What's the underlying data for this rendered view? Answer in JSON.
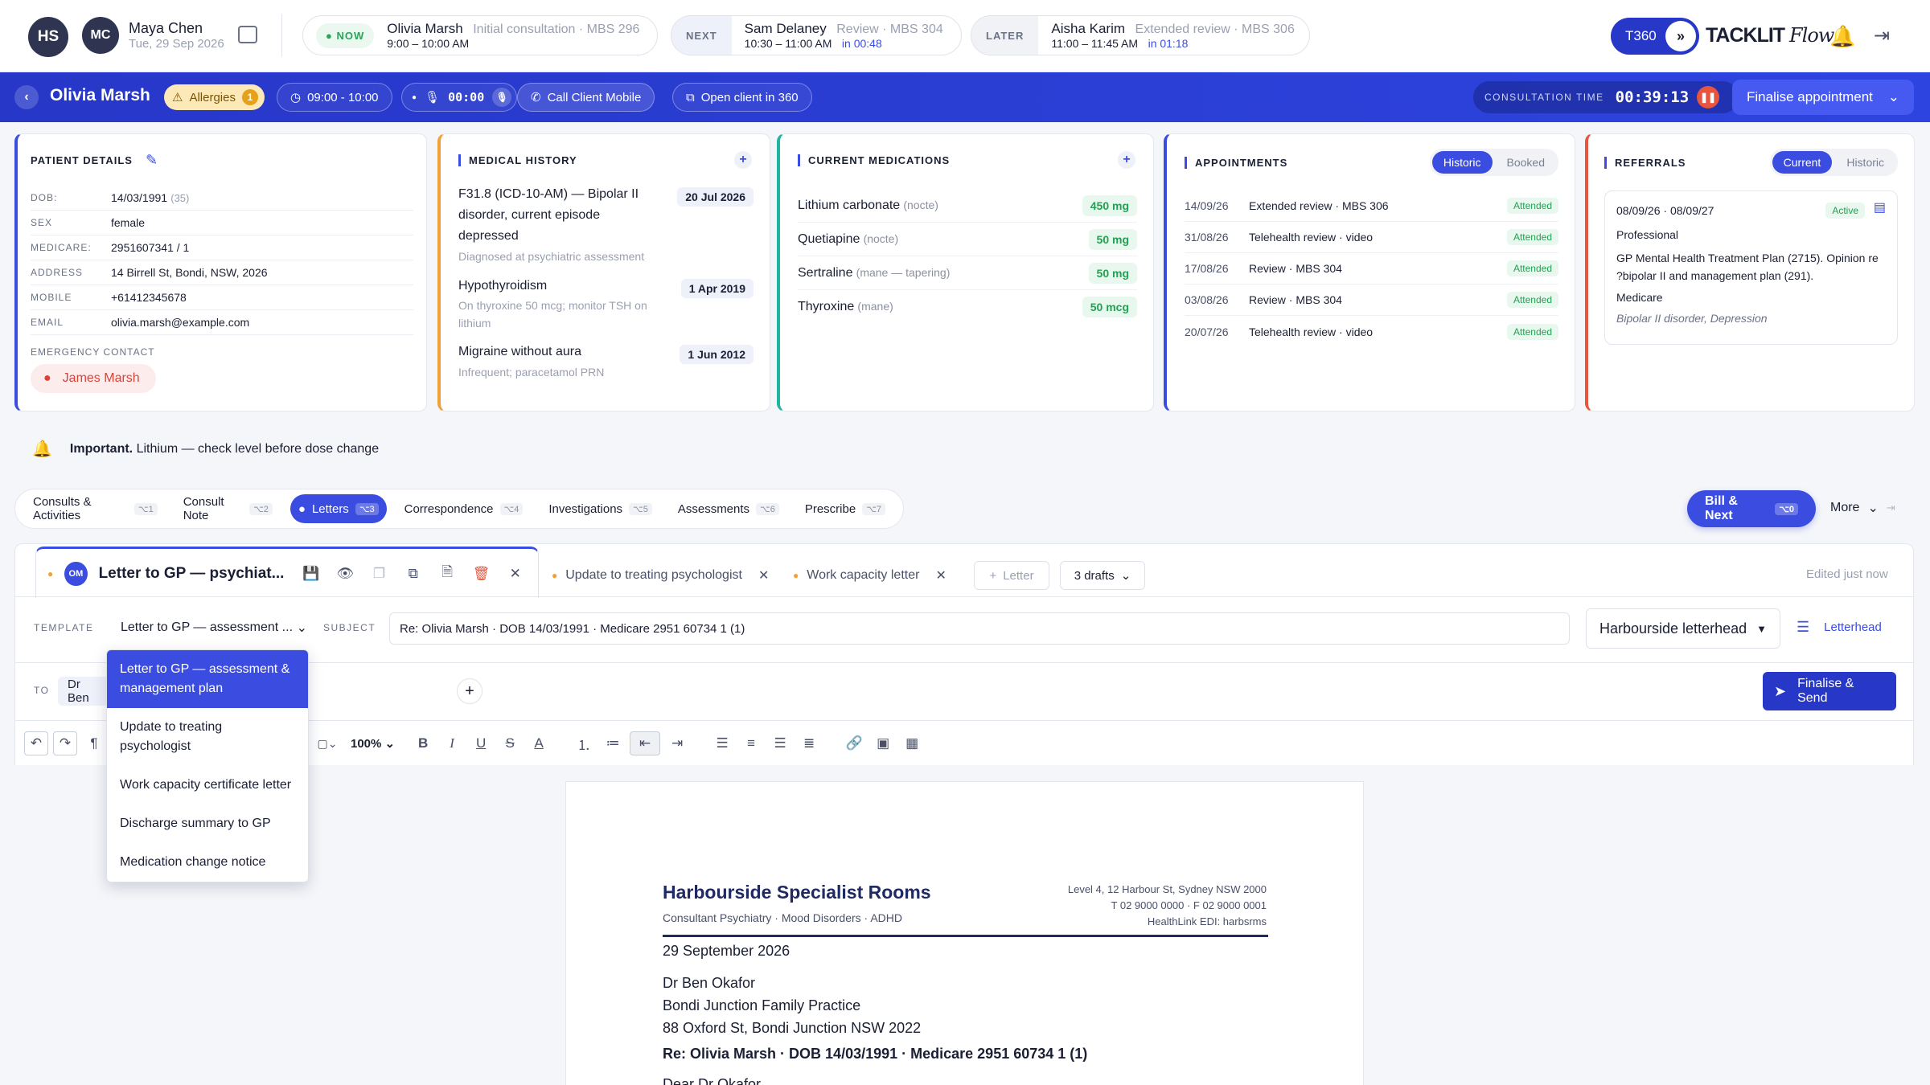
{
  "practitioner": {
    "initials": "HS"
  },
  "user": {
    "initials": "MC",
    "name": "Maya Chen",
    "date": "Tue, 29 Sep 2026"
  },
  "queue": {
    "now": {
      "pill": "NOW",
      "name": "Olivia Marsh",
      "detail": "Initial consultation · MBS 296",
      "time": "9:00 – 10:00 AM"
    },
    "next": {
      "pill": "NEXT",
      "name": "Sam Delaney",
      "detail": "Review · MBS 304",
      "time": "10:30 – 11:00 AM",
      "in": "in 00:48"
    },
    "later": {
      "pill": "LATER",
      "name": "Aisha Karim",
      "detail": "Extended review · MBS 306",
      "time": "11:00 – 11:45 AM",
      "in": "in 01:18"
    }
  },
  "brand": {
    "badge": "T360",
    "name": "TACKLIT",
    "script": "Flow"
  },
  "patientbar": {
    "name": "Olivia Marsh",
    "allergies": "Allergies",
    "allergy_count": "1",
    "slot": "09:00 - 10:00",
    "timer": "00:00",
    "call": "Call Client Mobile",
    "open": "Open client in 360",
    "consult_label": "CONSULTATION TIME",
    "consult_time": "00:39:13",
    "finalise": "Finalise appointment"
  },
  "details": {
    "title": "PATIENT DETAILS",
    "rows": [
      {
        "k": "DOB:",
        "v": "14/03/1991",
        "extra": "(35)"
      },
      {
        "k": "SEX",
        "v": "female"
      },
      {
        "k": "MEDICARE:",
        "v": "2951607341 / 1"
      },
      {
        "k": "ADDRESS",
        "v": "14 Birrell St, Bondi, NSW, 2026"
      },
      {
        "k": "MOBILE",
        "v": "+61412345678"
      },
      {
        "k": "EMAIL",
        "v": "olivia.marsh@example.com"
      }
    ],
    "emergency_label": "EMERGENCY CONTACT",
    "emergency_name": "James Marsh"
  },
  "history": {
    "title": "MEDICAL HISTORY",
    "items": [
      {
        "title": "F31.8 (ICD-10-AM) — Bipolar II disorder, current episode depressed",
        "note": "Diagnosed at psychiatric assessment",
        "date": "20 Jul 2026"
      },
      {
        "title": "Hypothyroidism",
        "note": "On thyroxine 50 mcg; monitor TSH on lithium",
        "date": "1 Apr 2019"
      },
      {
        "title": "Migraine without aura",
        "note": "Infrequent; paracetamol PRN",
        "date": "1 Jun 2012"
      }
    ]
  },
  "medications": {
    "title": "CURRENT MEDICATIONS",
    "items": [
      {
        "name": "Lithium carbonate",
        "when": "(nocte)",
        "dose": "450 mg"
      },
      {
        "name": "Quetiapine",
        "when": "(nocte)",
        "dose": "50 mg"
      },
      {
        "name": "Sertraline",
        "when": "(mane — tapering)",
        "dose": "50 mg"
      },
      {
        "name": "Thyroxine",
        "when": "(mane)",
        "dose": "50 mcg"
      }
    ]
  },
  "appointments": {
    "title": "APPOINTMENTS",
    "seg": [
      "Historic",
      "Booked"
    ],
    "items": [
      {
        "date": "14/09/26",
        "desc": "Extended review · MBS 306",
        "status": "Attended"
      },
      {
        "date": "31/08/26",
        "desc": "Telehealth review · video",
        "status": "Attended"
      },
      {
        "date": "17/08/26",
        "desc": "Review · MBS 304",
        "status": "Attended"
      },
      {
        "date": "03/08/26",
        "desc": "Review · MBS 304",
        "status": "Attended"
      },
      {
        "date": "20/07/26",
        "desc": "Telehealth review · video",
        "status": "Attended"
      }
    ]
  },
  "referrals": {
    "title": "REFERRALS",
    "seg": [
      "Current",
      "Historic"
    ],
    "range_start": "08/09/26",
    "range_end": "08/09/27",
    "status": "Active",
    "type": "Professional",
    "desc": "GP Mental Health Treatment Plan (2715). Opinion re ?bipolar II and management plan (291).",
    "payer": "Medicare",
    "dx": "Bipolar II disorder, Depression"
  },
  "alert": {
    "strong": "Important.",
    "text": "Lithium — check level before dose change"
  },
  "tabs": [
    {
      "label": "Consults & Activities",
      "key": "⌥1"
    },
    {
      "label": "Consult Note",
      "key": "⌥2"
    },
    {
      "label": "Letters",
      "key": "⌥3"
    },
    {
      "label": "Correspondence",
      "key": "⌥4"
    },
    {
      "label": "Investigations",
      "key": "⌥5"
    },
    {
      "label": "Assessments",
      "key": "⌥6"
    },
    {
      "label": "Prescribe",
      "key": "⌥7"
    }
  ],
  "bill": {
    "label": "Bill & Next",
    "key": "⌥0",
    "more": "More"
  },
  "doctabs": {
    "active_initials": "OM",
    "active": "Letter to GP — psychiat...",
    "t2": "Update to treating psychologist",
    "t3": "Work capacity letter",
    "add": "Letter",
    "drafts": "3 drafts",
    "edited": "Edited just now"
  },
  "compose": {
    "template_label": "TEMPLATE",
    "template_value": "Letter to GP — assessment ...",
    "subject_label": "SUBJECT",
    "subject": "Re: Olivia Marsh · DOB 14/03/1991 · Medicare 2951 60734 1 (1)",
    "letterhead": "Harbourside letterhead",
    "letterhead_btn": "Letterhead",
    "to_label": "TO",
    "to_value": "Dr Ben",
    "finalise": "Finalise & Send",
    "zoom": "100%"
  },
  "dropdown": [
    "Letter to GP — assessment & management plan",
    "Update to treating psychologist",
    "Work capacity certificate letter",
    "Discharge summary to GP",
    "Medication change notice"
  ],
  "letter": {
    "org": "Harbourside Specialist Rooms",
    "sub": "Consultant Psychiatry · Mood Disorders · ADHD",
    "addr1": "Level 4, 12 Harbour St, Sydney NSW 2000",
    "addr2": "T 02 9000 0000 · F 02 9000 0001",
    "addr3": "HealthLink EDI: harbsrms",
    "date": "29 September 2026",
    "to1": "Dr Ben Okafor",
    "to2": "Bondi Junction Family Practice",
    "to3": "88 Oxford St, Bondi Junction NSW 2022",
    "re": "Re: Olivia Marsh · DOB 14/03/1991 · Medicare 2951 60734 1 (1)",
    "dear": "Dear Dr Okafor"
  },
  "colors": {
    "accent": "#3b4de0",
    "history": "#f0a23a",
    "meds": "#1fb5a0",
    "appts": "#3b4de0",
    "referrals": "#e8553f"
  }
}
